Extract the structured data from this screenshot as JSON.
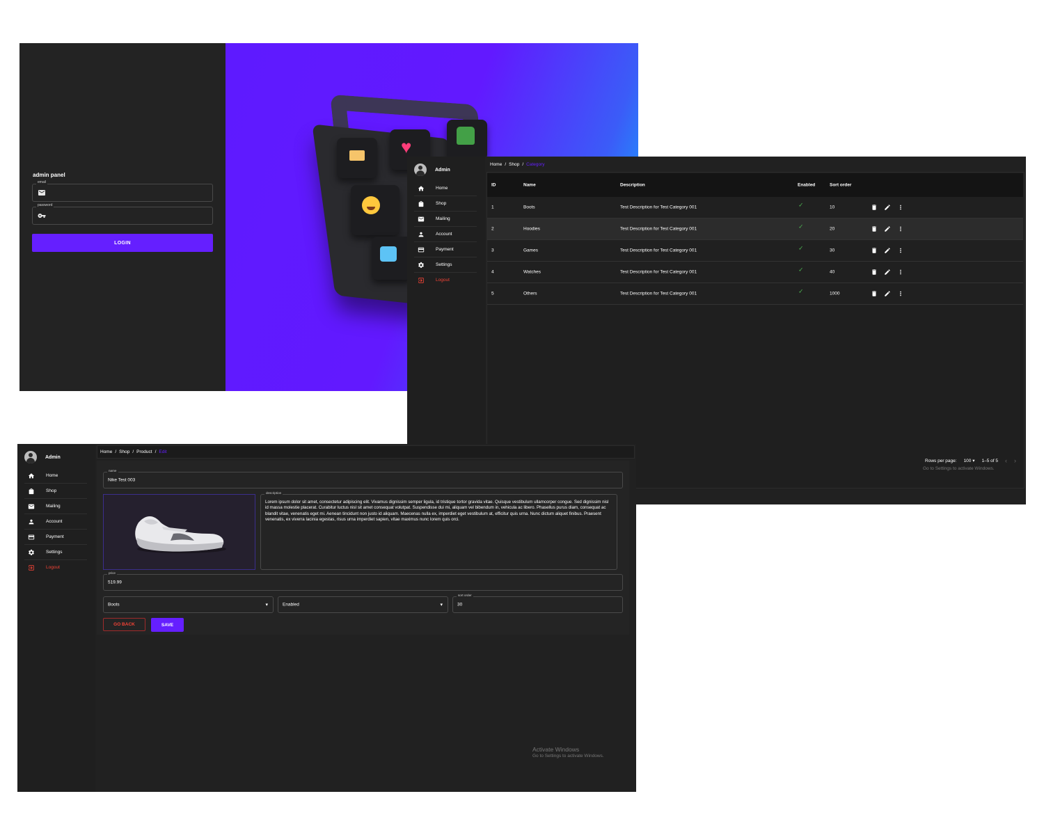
{
  "login": {
    "title": "admin panel",
    "email_label": "email",
    "password_label": "password",
    "login_button": "LOGIN"
  },
  "sidebar": {
    "user_name": "Admin",
    "items": [
      {
        "label": "Home",
        "icon": "home-icon"
      },
      {
        "label": "Shop",
        "icon": "shopping-bag-icon"
      },
      {
        "label": "Mailing",
        "icon": "mail-icon"
      },
      {
        "label": "Account",
        "icon": "person-icon"
      },
      {
        "label": "Payment",
        "icon": "credit-card-icon"
      },
      {
        "label": "Settings",
        "icon": "gear-icon"
      },
      {
        "label": "Logout",
        "icon": "logout-icon"
      }
    ]
  },
  "category": {
    "breadcrumb": [
      "Home",
      "Shop",
      "Category"
    ],
    "separator": "/",
    "columns": [
      "ID",
      "Name",
      "Description",
      "Enabled",
      "Sort order"
    ],
    "rows": [
      {
        "id": "1",
        "name": "Boots",
        "description": "Test Description for Test Category 001",
        "sort": "10"
      },
      {
        "id": "2",
        "name": "Hoodies",
        "description": "Test Description for Test Category 001",
        "sort": "20"
      },
      {
        "id": "3",
        "name": "Games",
        "description": "Test Description for Test Category 001",
        "sort": "30"
      },
      {
        "id": "4",
        "name": "Watches",
        "description": "Test Description for Test Category 001",
        "sort": "40"
      },
      {
        "id": "5",
        "name": "Others",
        "description": "Test Description for Test Category 001",
        "sort": "1000"
      }
    ],
    "enabled_mark": "✓",
    "pagination": {
      "rows_per_page_label": "Rows per page:",
      "rows_per_page": "100",
      "range": "1–5 of 5"
    }
  },
  "product_edit": {
    "breadcrumb": [
      "Home",
      "Shop",
      "Product",
      "Edit"
    ],
    "separator": "/",
    "name_label": "name",
    "name_value": "Nike Test 003",
    "description_label": "description",
    "description_value": "Lorem ipsum dolor sit amet, consectetur adipiscing elit. Vivamus dignissim semper ligula, id tristique tortor gravida vitae. Quisque vestibulum ullamcorper congue. Sed dignissim nisl id massa molestie placerat. Curabitur luctus nisl sit amet consequat volutpat. Suspendisse dui mi, aliquam vel bibendum in, vehicula ac libero. Phasellus purus diam, consequat ac blandit vitae, venenatis eget mi. Aenean tincidunt non justo id aliquam. Maecenas nulla ex, imperdiet eget vestibulum at, efficitur quis urna. Nunc dictum aliquet finibus. Praesent venenatis, ex viverra lacinia egestas, risus urna imperdiet sapien, vitae maximus nunc lorem quis orci.",
    "price_label": "price",
    "price_value": "519.99",
    "category_value": "Boots",
    "status_value": "Enabled",
    "sort_order_label": "sort order",
    "sort_order_value": "30",
    "go_back_button": "GO BACK",
    "save_button": "SAVE"
  },
  "watermark": {
    "title": "Activate Windows",
    "subtitle": "Go to Settings to activate Windows."
  },
  "colors": {
    "accent": "#651fff",
    "danger": "#f44336",
    "success": "#4caf50",
    "panel": "#212121"
  }
}
